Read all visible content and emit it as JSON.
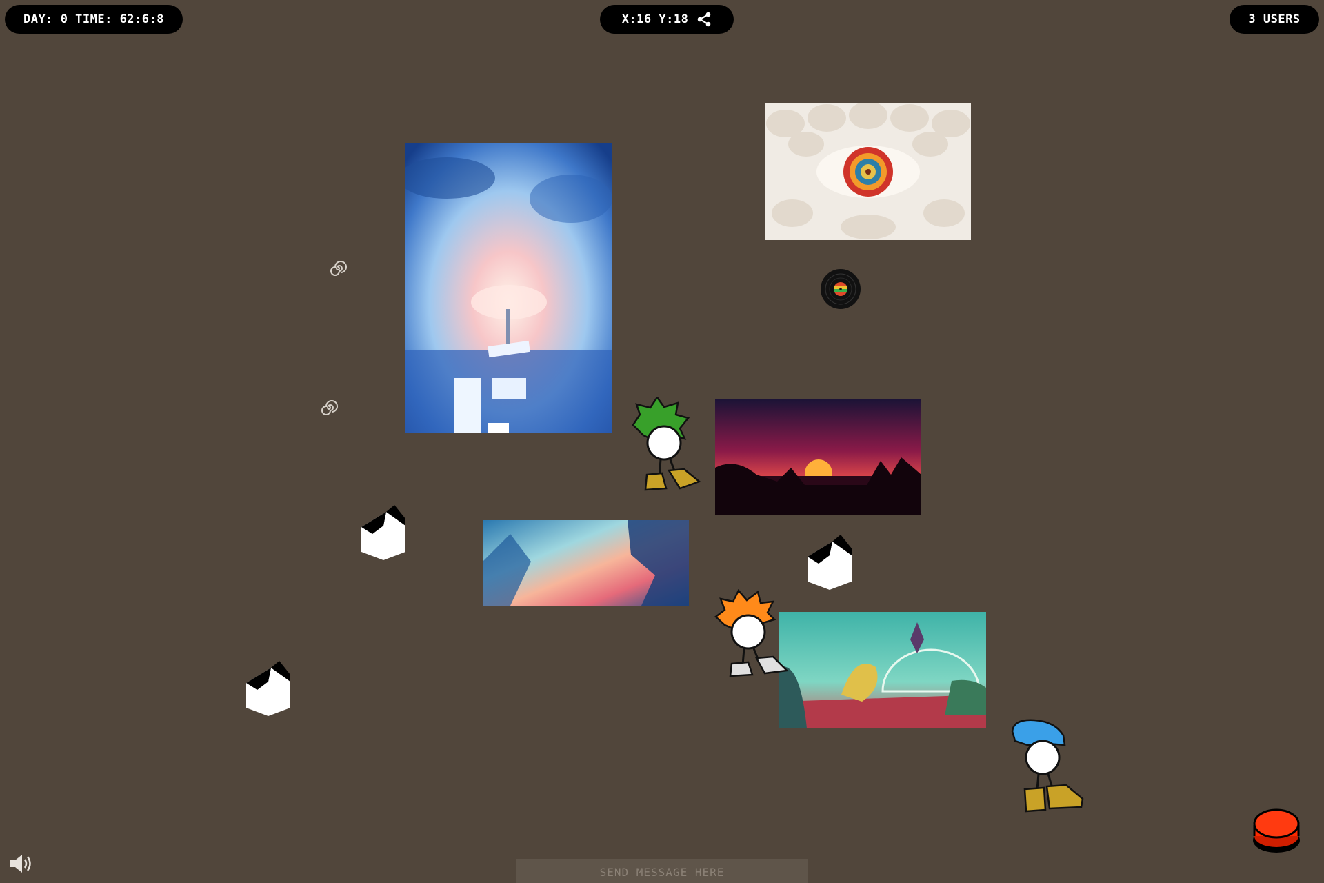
{
  "hud": {
    "day_time": "DAY: 0 TIME: 62:6:8",
    "coords": "X:16 Y:18",
    "users": "3 USERS"
  },
  "chat": {
    "placeholder": "SEND MESSAGE HERE"
  },
  "icons": {
    "share": "share-icon",
    "sound": "speaker-icon",
    "button": "red-button-icon",
    "record": "vinyl-record-icon",
    "house": "house-icon",
    "spiral": "spiral-icon"
  },
  "colors": {
    "background": "#51463b",
    "pill": "#000000",
    "pill_text": "#ffffff",
    "button": "#ff2a00",
    "green_hair": "#38a02a",
    "orange_hair": "#ff8a1a",
    "blue_hair": "#3aa0e8",
    "shoes": "#c9a227"
  }
}
